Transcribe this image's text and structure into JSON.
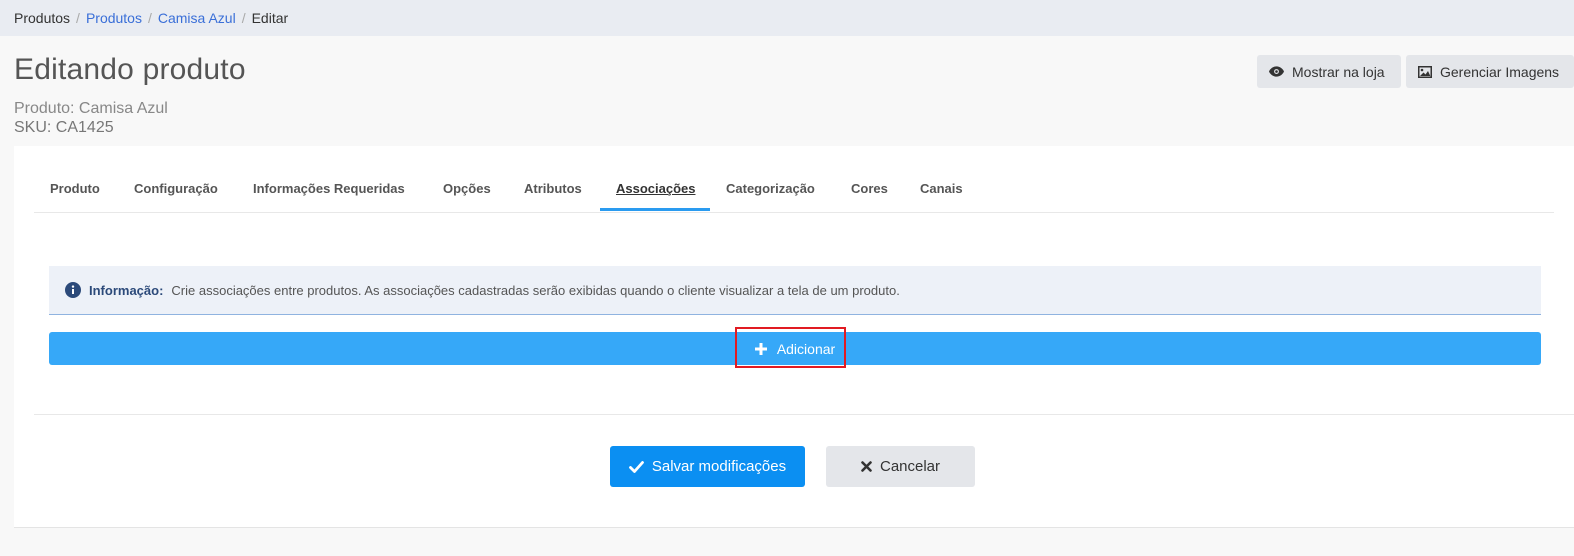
{
  "breadcrumb": {
    "items": [
      {
        "label": "Produtos",
        "link": false
      },
      {
        "label": "Produtos",
        "link": true
      },
      {
        "label": "Camisa Azul",
        "link": true
      },
      {
        "label": "Editar",
        "link": false
      }
    ],
    "separator": "/"
  },
  "header": {
    "title": "Editando produto",
    "product_line": "Produto: Camisa Azul",
    "sku_line": "SKU: CA1425",
    "show_store_label": "Mostrar na loja",
    "manage_images_label": "Gerenciar Imagens"
  },
  "tabs": [
    {
      "label": "Produto"
    },
    {
      "label": "Configuração"
    },
    {
      "label": "Informações Requeridas"
    },
    {
      "label": "Opções"
    },
    {
      "label": "Atributos"
    },
    {
      "label": "Associações",
      "active": true
    },
    {
      "label": "Categorização"
    },
    {
      "label": "Cores"
    },
    {
      "label": "Canais"
    }
  ],
  "info": {
    "label": "Informação:",
    "text": "Crie associações entre produtos. As associações cadastradas serão exibidas quando o cliente visualizar a tela de um produto."
  },
  "add_button": {
    "label": "Adicionar"
  },
  "footer": {
    "save_label": "Salvar modificações",
    "cancel_label": "Cancelar"
  },
  "colors": {
    "accent": "#2a9bf0",
    "add_bar": "#36a8f8",
    "save": "#0b8ff2",
    "highlight": "#e11b22"
  },
  "icons": {
    "show_store": "eye-icon",
    "manage_images": "image-icon",
    "info": "info-circle-icon",
    "add": "plus-icon",
    "save": "check-icon",
    "cancel": "x-icon"
  }
}
